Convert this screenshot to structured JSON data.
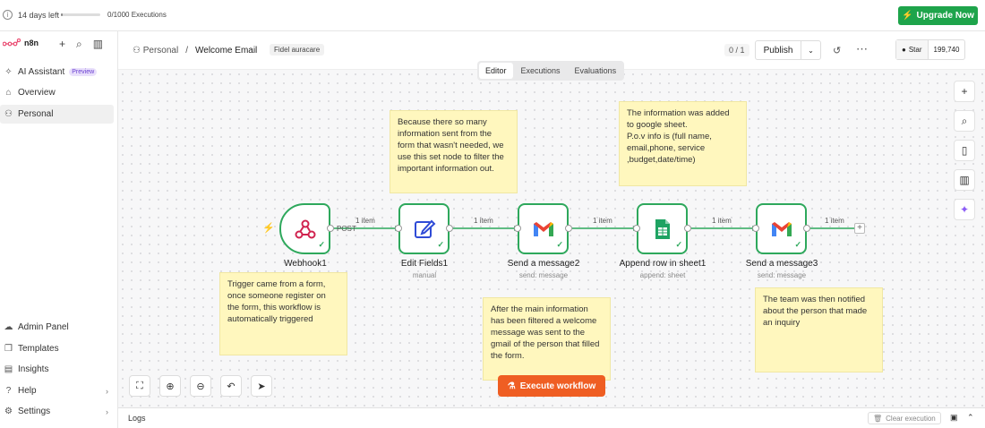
{
  "trial": {
    "days_left": "14 days left",
    "executions": "0/1000 Executions",
    "progress": 0.0,
    "upgrade_label": "Upgrade Now"
  },
  "sidebar": {
    "logo_text": "n8n",
    "items": [
      {
        "label": "AI Assistant",
        "badge": "Preview",
        "icon": "sparkles-icon"
      },
      {
        "label": "Overview",
        "icon": "home-icon"
      },
      {
        "label": "Personal",
        "icon": "user-icon"
      }
    ],
    "bottom_items": [
      {
        "label": "Admin Panel",
        "icon": "cloud-icon"
      },
      {
        "label": "Templates",
        "icon": "box-icon"
      },
      {
        "label": "Insights",
        "icon": "chart-icon"
      },
      {
        "label": "Help",
        "icon": "help-icon"
      },
      {
        "label": "Settings",
        "icon": "gear-icon"
      }
    ]
  },
  "header": {
    "project": "Personal",
    "separator": "/",
    "workflow_title": "Welcome Email",
    "tag": "Fidel auracare",
    "counter": "0 / 1",
    "publish_label": "Publish",
    "github_star_label": "Star",
    "github_stars": "199,740"
  },
  "tabs": [
    "Editor",
    "Executions",
    "Evaluations"
  ],
  "selected_tab": "Editor",
  "notes": {
    "n1": "Because there so many information sent from the form that wasn't needed, we use this set node to filter the important information out.",
    "n2": "The information was added to google sheet.\nP.o.v info is (full name, email,phone, service ,budget,date/time)",
    "n3": "Trigger came from a form, once someone register on the form, this workflow is automatically triggered",
    "n4": "After the main information has been filtered a welcome message was sent to the gmail of the person that filled the form.",
    "n5": "The team was then notified about the person that made an inquiry"
  },
  "nodes": [
    {
      "label": "Webhook1",
      "sub": "",
      "port_label": "POST"
    },
    {
      "label": "Edit Fields1",
      "sub": "manual"
    },
    {
      "label": "Send a message2",
      "sub": "send: message"
    },
    {
      "label": "Append row in sheet1",
      "sub": "append: sheet"
    },
    {
      "label": "Send a message3",
      "sub": "send: message"
    }
  ],
  "connections": [
    "1 item",
    "1 item",
    "1 item",
    "1 item",
    "1 item"
  ],
  "execute_label": "Execute workflow",
  "logs": {
    "label": "Logs",
    "clear_label": "Clear execution"
  }
}
